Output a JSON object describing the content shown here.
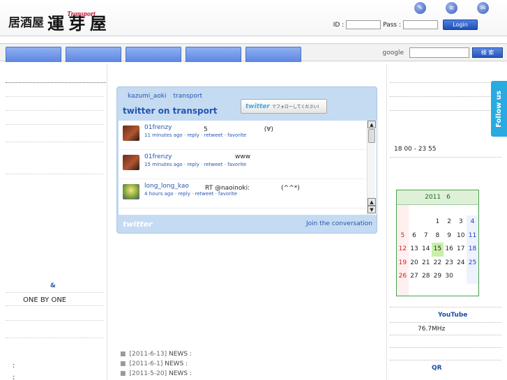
{
  "header": {
    "logo_prefix": "居酒屋",
    "logo_main": "運 芽 屋",
    "logo_en": "Transport",
    "icons": [
      "edit-icon",
      "list-icon",
      "mail-icon"
    ],
    "login": {
      "id_label": "ID :",
      "pass_label": "Pass :",
      "button": "Login"
    }
  },
  "nav": {
    "tabs_count": 5,
    "search_label": "google",
    "search_button": "検 索"
  },
  "left": {
    "ampersand": "&",
    "one_by_one": "ONE BY ONE",
    "colon1": ":",
    "colon2": ":"
  },
  "twitter": {
    "link_user": "kazumi_aoki",
    "link_list": "transport",
    "title": "twitter on transport",
    "follow_logo": "twitter",
    "follow_text": "でフォローしてください!",
    "tweets": [
      {
        "user": "01frenzy",
        "text": "5　　　　　　　　　(∀)",
        "meta": "11 minutes ago · reply · retweet · favorite"
      },
      {
        "user": "01frenzy",
        "text": "www",
        "meta": "15 minutes ago · reply · retweet · favorite"
      },
      {
        "user": "long_long_kao",
        "text": "RT @naoinoki:　　　　　(^^*)",
        "meta": "4 hours ago · reply · retweet · favorite"
      }
    ],
    "footer_logo": "twitter",
    "join": "Join the conversation"
  },
  "news": [
    {
      "date": "[2011-6-13]",
      "label": "NEWS :"
    },
    {
      "date": "[2011-6-1]",
      "label": "NEWS :"
    },
    {
      "date": "[2011-5-20]",
      "label": "NEWS :"
    }
  ],
  "right": {
    "hours": "18 00 - 23 55",
    "calendar": {
      "year": "2011",
      "month": "6",
      "weeks": [
        [
          "",
          "",
          "",
          "1",
          "2",
          "3",
          "4"
        ],
        [
          "5",
          "6",
          "7",
          "8",
          "9",
          "10",
          "11"
        ],
        [
          "12",
          "13",
          "14",
          "15",
          "16",
          "17",
          "18"
        ],
        [
          "19",
          "20",
          "21",
          "22",
          "23",
          "24",
          "25"
        ],
        [
          "26",
          "27",
          "28",
          "29",
          "30",
          "",
          ""
        ]
      ],
      "today": "15"
    },
    "youtube": "YouTube",
    "radio": "76.7MHz",
    "qr": "QR",
    "follow_tab": "Follow us"
  },
  "colors": {
    "accent": "#2556b0",
    "nav": "#5b86e2",
    "twitter": "#29aae1",
    "calendar_border": "#49a24c"
  }
}
